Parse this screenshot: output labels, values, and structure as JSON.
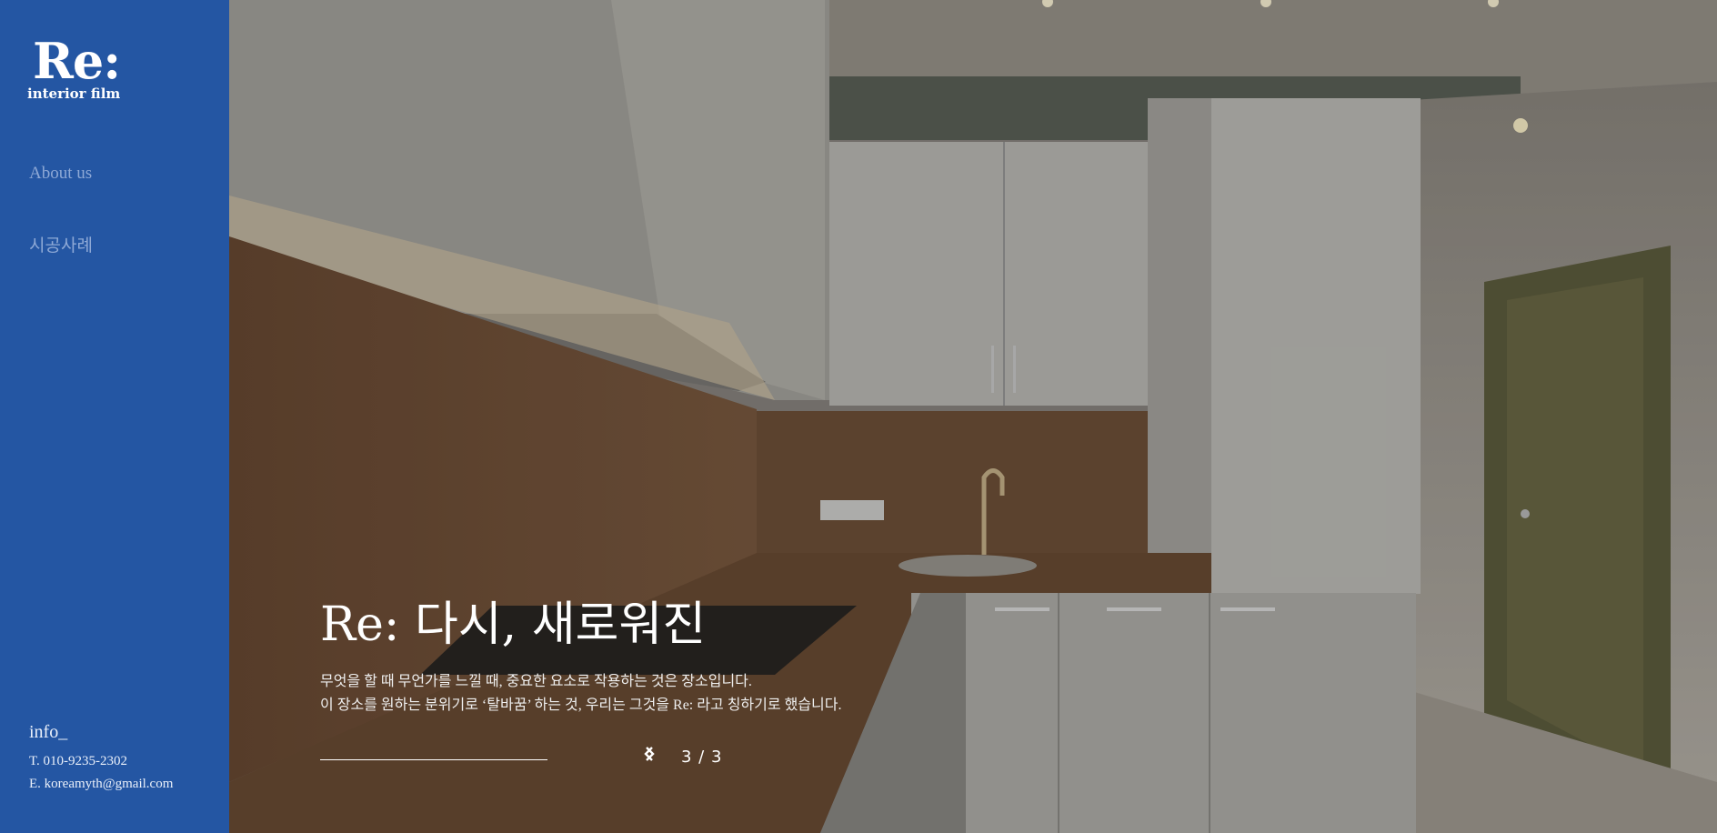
{
  "brand": {
    "logo": "Re:",
    "tagline": "interior film"
  },
  "nav": [
    {
      "label": "About us"
    },
    {
      "label": "시공사례"
    }
  ],
  "info": {
    "title": "info_",
    "phone": "T. 010-9235-2302",
    "email": "E. koreamyth@gmail.com"
  },
  "hero": {
    "headline": "Re: 다시, 새로워진",
    "line1": "무엇을 할 때 무언가를 느낄 때, 중요한 요소로 작용하는 것은 장소입니다.",
    "line2": "이 장소를 원하는 분위기로 ‘탈바꿈’ 하는 것, 우리는 그것을 Re: 라고 칭하기로 했습니다.",
    "progress": 1.0,
    "slide_counter": "3 / 3",
    "prev_icon": "chevron-left-icon",
    "next_icon": "chevron-right-icon"
  },
  "colors": {
    "sidebar": "#2456a3",
    "nav_text": "#8ea9d6"
  }
}
